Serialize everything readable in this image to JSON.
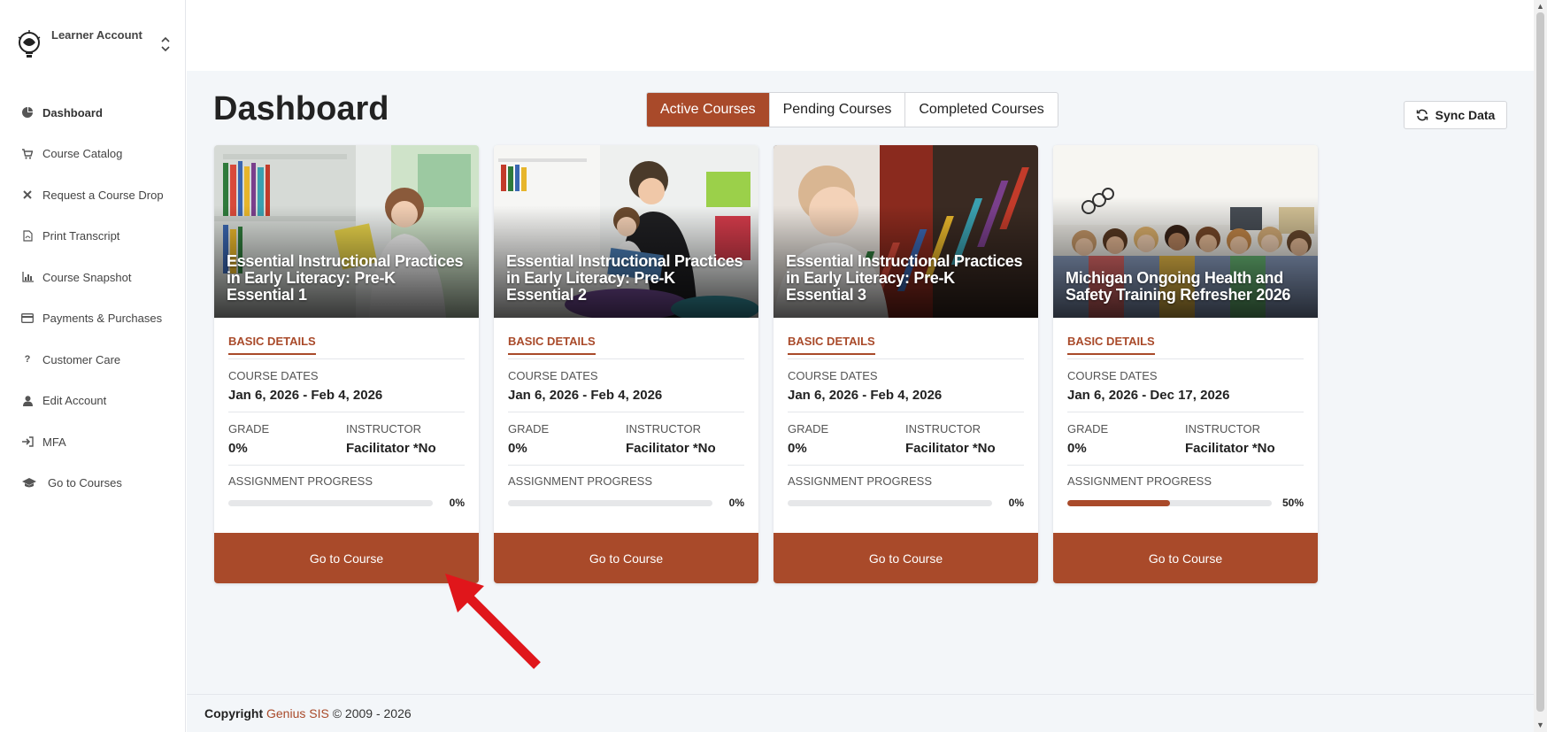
{
  "account": {
    "name": "Learner Account"
  },
  "sidebar": {
    "items": [
      {
        "label": "Dashboard",
        "icon": "dashboard-icon",
        "active": true
      },
      {
        "label": "Course Catalog",
        "icon": "cart-icon"
      },
      {
        "label": "Request a Course Drop",
        "icon": "close-icon"
      },
      {
        "label": "Print Transcript",
        "icon": "pdf-icon"
      },
      {
        "label": "Course Snapshot",
        "icon": "chart-icon"
      },
      {
        "label": "Payments & Purchases",
        "icon": "credit-card-icon"
      },
      {
        "label": "Customer Care",
        "icon": "question-icon"
      },
      {
        "label": "Edit Account",
        "icon": "user-icon"
      },
      {
        "label": "MFA",
        "icon": "sign-in-icon"
      },
      {
        "label": "Go to Courses",
        "icon": "graduation-cap-icon"
      }
    ]
  },
  "page": {
    "title": "Dashboard"
  },
  "tabs": [
    {
      "label": "Active Courses",
      "active": true
    },
    {
      "label": "Pending Courses"
    },
    {
      "label": "Completed Courses"
    }
  ],
  "sync": {
    "label": "Sync Data"
  },
  "labels": {
    "basic_details": "BASIC DETAILS",
    "course_dates": "COURSE DATES",
    "grade": "GRADE",
    "instructor": "INSTRUCTOR",
    "assignment_progress": "ASSIGNMENT PROGRESS",
    "go_to_course": "Go to Course"
  },
  "cards": [
    {
      "title": "Essential Instructional Practices in Early Literacy: Pre-K Essential 1",
      "dates": "Jan 6, 2026 - Feb 4, 2026",
      "grade": "0%",
      "instructor": "Facilitator *No",
      "progress": 0,
      "progress_label": "0%"
    },
    {
      "title": "Essential Instructional Practices in Early Literacy: Pre-K Essential 2",
      "dates": "Jan 6, 2026 - Feb 4, 2026",
      "grade": "0%",
      "instructor": "Facilitator *No",
      "progress": 0,
      "progress_label": "0%"
    },
    {
      "title": "Essential Instructional Practices in Early Literacy: Pre-K Essential 3",
      "dates": "Jan 6, 2026 - Feb 4, 2026",
      "grade": "0%",
      "instructor": "Facilitator *No",
      "progress": 0,
      "progress_label": "0%"
    },
    {
      "title": "Michigan Ongoing Health and Safety Training Refresher 2026",
      "dates": "Jan 6, 2026 - Dec 17, 2026",
      "grade": "0%",
      "instructor": "Facilitator *No",
      "progress": 0.5,
      "progress_label": "50%"
    }
  ],
  "footer": {
    "prefix": "Copyright",
    "brand": "Genius SIS",
    "suffix": "© 2009 - 2026"
  },
  "colors": {
    "accent": "#a94a2a",
    "background": "#f3f6f9",
    "annotation_arrow": "#e0161b"
  }
}
